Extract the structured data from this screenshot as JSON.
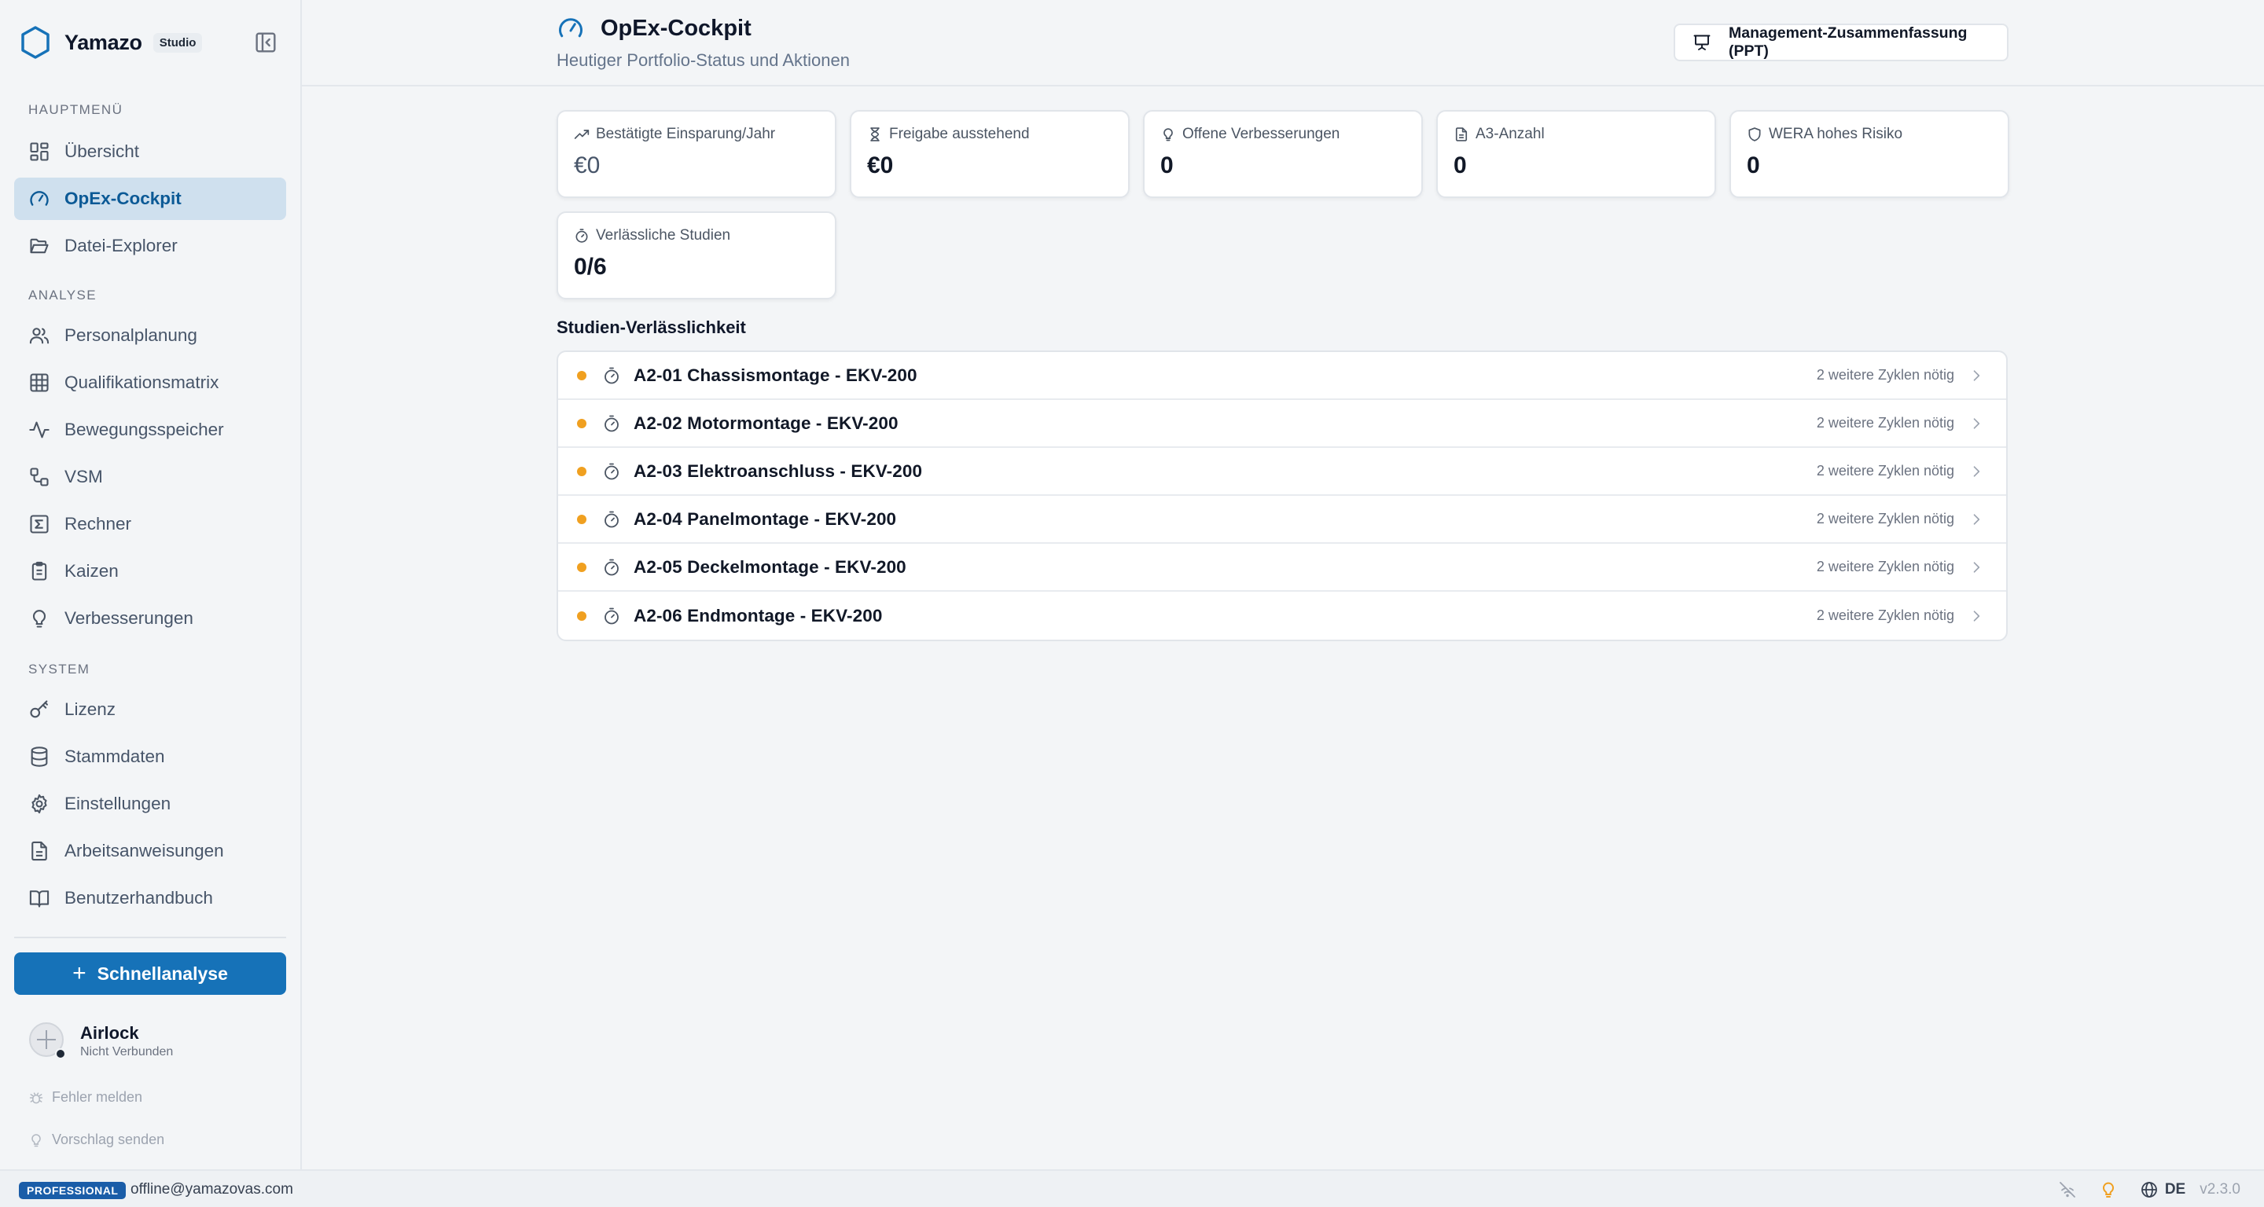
{
  "brand": {
    "name": "Yamazo",
    "badge": "Studio"
  },
  "sidebar": {
    "sections": {
      "main": "HAUPTMENÜ",
      "analysis": "ANALYSE",
      "system": "SYSTEM"
    },
    "items": [
      {
        "id": "overview",
        "label": "Übersicht",
        "icon": "dashboard-grid-icon"
      },
      {
        "id": "opex",
        "label": "OpEx-Cockpit",
        "icon": "gauge-icon",
        "active": true
      },
      {
        "id": "explorer",
        "label": "Datei-Explorer",
        "icon": "folder-open-icon"
      },
      {
        "id": "staff",
        "label": "Personalplanung",
        "icon": "users-icon"
      },
      {
        "id": "matrix",
        "label": "Qualifikationsmatrix",
        "icon": "grid-icon"
      },
      {
        "id": "motion",
        "label": "Bewegungsspeicher",
        "icon": "activity-icon"
      },
      {
        "id": "vsm",
        "label": "VSM",
        "icon": "workflow-icon"
      },
      {
        "id": "calc",
        "label": "Rechner",
        "icon": "sigma-icon"
      },
      {
        "id": "kaizen",
        "label": "Kaizen",
        "icon": "clipboard-icon"
      },
      {
        "id": "improve",
        "label": "Verbesserungen",
        "icon": "lightbulb-icon"
      },
      {
        "id": "license",
        "label": "Lizenz",
        "icon": "key-icon"
      },
      {
        "id": "master",
        "label": "Stammdaten",
        "icon": "database-icon"
      },
      {
        "id": "settings",
        "label": "Einstellungen",
        "icon": "gear-icon"
      },
      {
        "id": "instructions",
        "label": "Arbeitsanweisungen",
        "icon": "file-text-icon"
      },
      {
        "id": "manual",
        "label": "Benutzerhandbuch",
        "icon": "book-open-icon"
      }
    ],
    "quick_action": "Schnellanalyse",
    "airlock": {
      "title": "Airlock",
      "status": "Nicht Verbunden"
    },
    "footer_links": {
      "bug": "Fehler melden",
      "suggest": "Vorschlag senden"
    }
  },
  "header": {
    "title": "OpEx-Cockpit",
    "subtitle": "Heutiger Portfolio-Status und Aktionen",
    "export_button": "Management-Zusammenfassung (PPT)"
  },
  "kpis": [
    {
      "label": "Bestätigte Einsparung/Jahr",
      "value": "€0",
      "icon": "trending-up-icon"
    },
    {
      "label": "Freigabe ausstehend",
      "value": "€0",
      "icon": "hourglass-icon"
    },
    {
      "label": "Offene Verbesserungen",
      "value": "0",
      "icon": "lightbulb-icon"
    },
    {
      "label": "A3-Anzahl",
      "value": "0",
      "icon": "file-text-icon"
    },
    {
      "label": "WERA hohes Risiko",
      "value": "0",
      "icon": "shield-icon"
    },
    {
      "label": "Verlässliche Studien",
      "value": "0/6",
      "icon": "timer-icon"
    }
  ],
  "studies": {
    "title": "Studien-Verlässlichkeit",
    "status_color": "#f0a020",
    "rows": [
      {
        "name": "A2-01 Chassismontage - EKV-200",
        "note": "2 weitere Zyklen nötig"
      },
      {
        "name": "A2-02 Motormontage - EKV-200",
        "note": "2 weitere Zyklen nötig"
      },
      {
        "name": "A2-03 Elektroanschluss - EKV-200",
        "note": "2 weitere Zyklen nötig"
      },
      {
        "name": "A2-04 Panelmontage - EKV-200",
        "note": "2 weitere Zyklen nötig"
      },
      {
        "name": "A2-05 Deckelmontage - EKV-200",
        "note": "2 weitere Zyklen nötig"
      },
      {
        "name": "A2-06 Endmontage - EKV-200",
        "note": "2 weitere Zyklen nötig"
      }
    ]
  },
  "statusbar": {
    "plan": "PROFESSIONAL",
    "email": "offline@yamazovas.com",
    "language": "DE",
    "version": "v2.3.0"
  },
  "colors": {
    "accent": "#1672b8",
    "active_bg": "#cfe0ee",
    "warning": "#f0a020"
  }
}
